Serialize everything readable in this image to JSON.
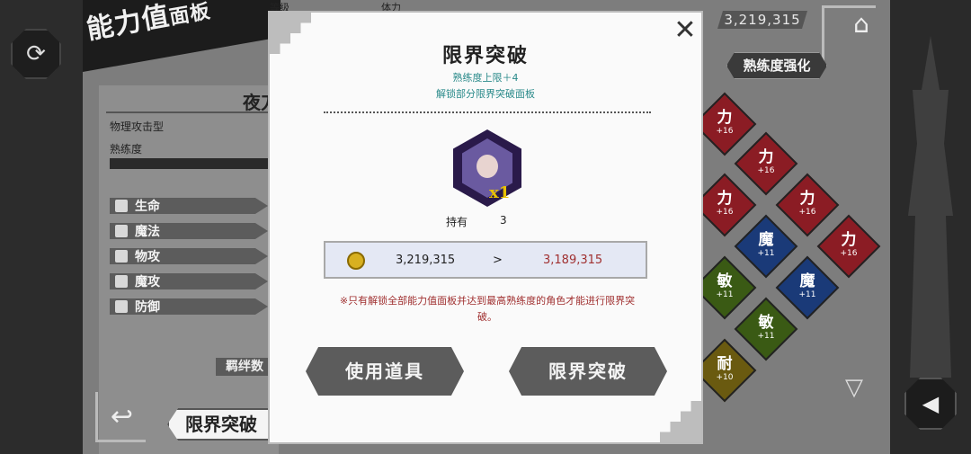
{
  "header": {
    "panel_title_main": "能力值",
    "panel_title_sub": "面板",
    "col_level": "等级",
    "col_stamina": "体力",
    "currency": "3,219,315",
    "mastery_button": "熟练度强化"
  },
  "character": {
    "name_partial": "夜刀",
    "type": "物理攻击型",
    "mastery_label": "熟练度",
    "stats": [
      {
        "label": "生命",
        "icon": "heart-icon"
      },
      {
        "label": "魔法",
        "icon": "magic-icon"
      },
      {
        "label": "物攻",
        "icon": "sword-icon"
      },
      {
        "label": "魔攻",
        "icon": "staff-icon"
      },
      {
        "label": "防御",
        "icon": "shield-icon"
      }
    ],
    "bond_label": "羁绊数",
    "limit_tab": "限界突破"
  },
  "grid": [
    {
      "k": "力",
      "v": "+16",
      "color": "#8b1c24"
    },
    {
      "k": "力",
      "v": "+16",
      "color": "#8b1c24"
    },
    {
      "k": "力",
      "v": "+16",
      "color": "#8b1c24"
    },
    {
      "k": "力",
      "v": "+16",
      "color": "#8b1c24"
    },
    {
      "k": "力",
      "v": "+16",
      "color": "#8b1c24"
    },
    {
      "k": "魔",
      "v": "+11",
      "color": "#1a3a78"
    },
    {
      "k": "敏",
      "v": "+11",
      "color": "#3a5a14"
    },
    {
      "k": "魔",
      "v": "+11",
      "color": "#1a3a78"
    },
    {
      "k": "敏",
      "v": "+11",
      "color": "#3a5a14"
    },
    {
      "k": "耐",
      "v": "+10",
      "color": "#6a5a10"
    }
  ],
  "modal": {
    "title": "限界突破",
    "sub1": "熟练度上限＋4",
    "sub2": "解锁部分限界突破面板",
    "item_count": "x1",
    "own_label": "持有",
    "own_value": "3",
    "cost_before": "3,219,315",
    "cost_arrow": ">",
    "cost_after": "3,189,315",
    "notice_line1": "※只有解锁全部能力值面板并达到最高熟练度的角色才能进行限界突",
    "notice_line2": "破。",
    "use_item_button": "使用道具",
    "limit_break_button": "限界突破"
  }
}
